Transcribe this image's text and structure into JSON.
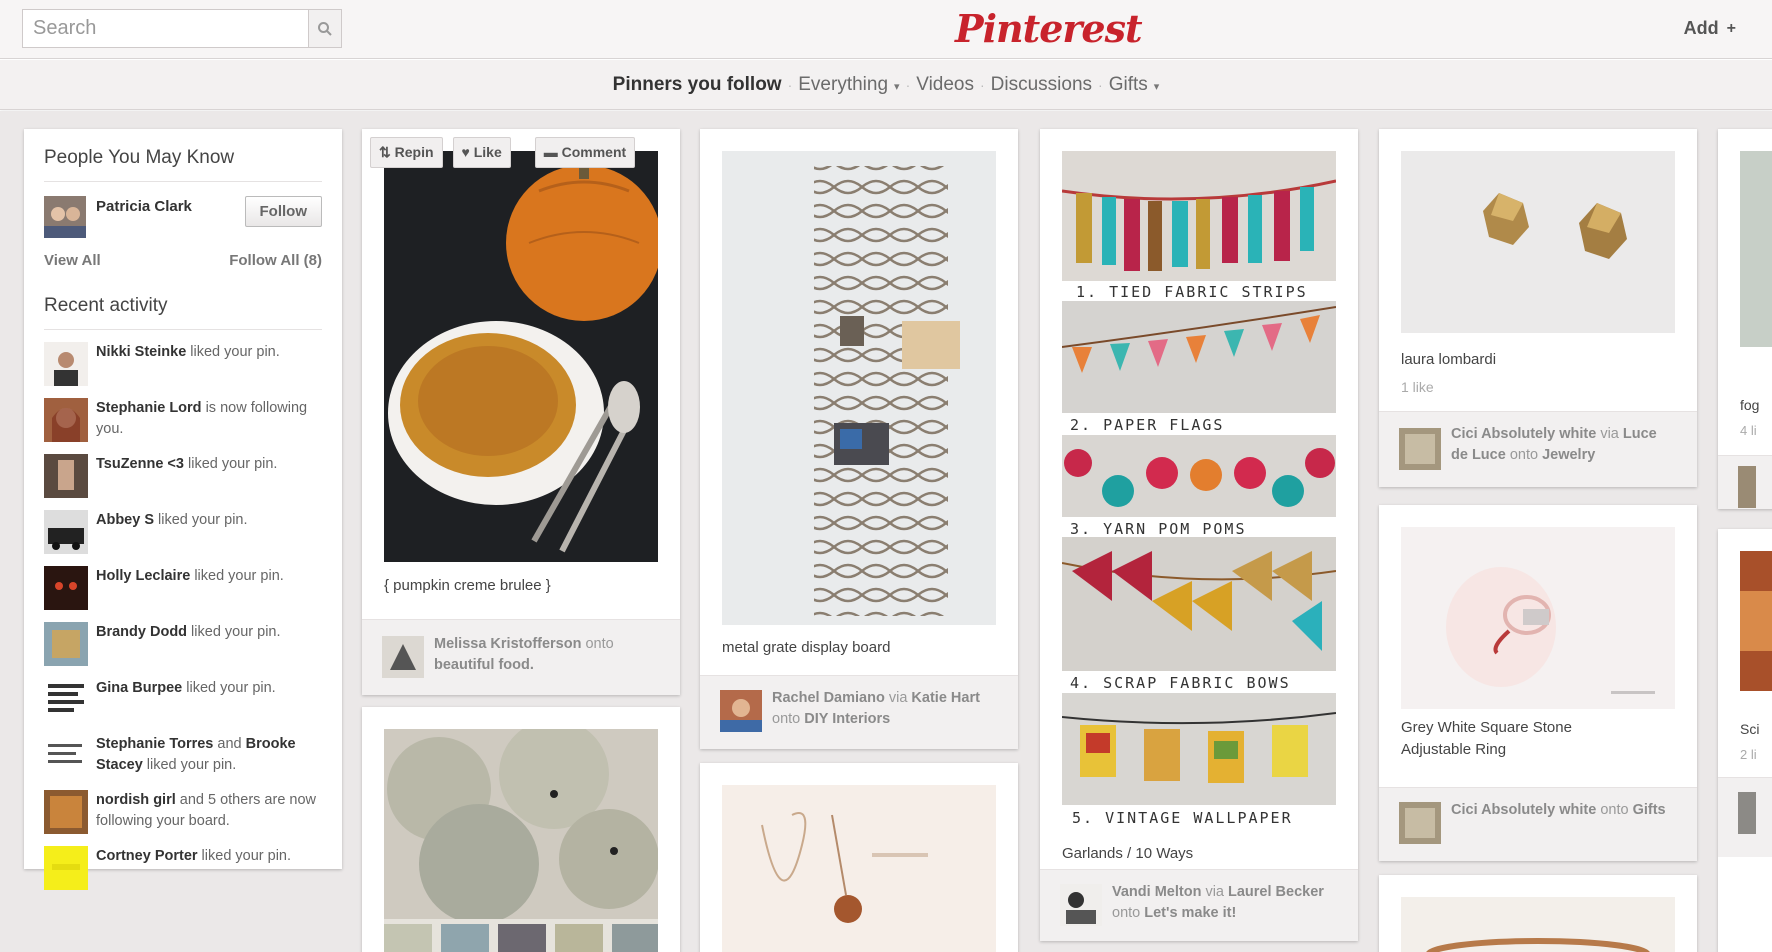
{
  "header": {
    "search": {
      "placeholder": "Search"
    },
    "logo": "Pinterest",
    "add_label": "Add",
    "icons": {
      "search": "search-icon",
      "add": "plus-icon"
    }
  },
  "nav": {
    "items": [
      {
        "label": "Pinners you follow"
      },
      {
        "label": "Everything"
      },
      {
        "label": "Videos"
      },
      {
        "label": "Discussions"
      },
      {
        "label": "Gifts"
      }
    ]
  },
  "sidebar": {
    "people_heading": "People You May Know",
    "person": {
      "name": "Patricia Clark",
      "follow_label": "Follow"
    },
    "view_all": "View All",
    "follow_all": "Follow All (8)",
    "recent_heading": "Recent activity",
    "activity": [
      {
        "name": "Nikki Steinke",
        "text": " liked your pin."
      },
      {
        "name": "Stephanie Lord",
        "text": " is now following you."
      },
      {
        "name": "TsuZenne <3",
        "text": " liked your pin."
      },
      {
        "name": "Abbey S",
        "text": " liked your pin."
      },
      {
        "name": "Holly Leclaire",
        "text": " liked your pin."
      },
      {
        "name": "Brandy Dodd",
        "text": " liked your pin."
      },
      {
        "name": "Gina Burpee",
        "text": " liked your pin."
      },
      {
        "name": "Stephanie Torres",
        "text": " and ",
        "name2": "Brooke Stacey",
        "text2": " liked your pin."
      },
      {
        "name": "nordish girl",
        "text": " and 5 others are now following your board."
      },
      {
        "name": "Cortney Porter",
        "text": " liked your pin."
      }
    ]
  },
  "pins": {
    "pumpkin": {
      "repin": "Repin",
      "like": "Like",
      "comment": "Comment",
      "description": "{ pumpkin creme brulee }",
      "foot_user": "Melissa Kristofferson",
      "foot_onto": " onto ",
      "foot_board": "beautiful food."
    },
    "metal": {
      "description": "metal grate display board",
      "foot_user": "Rachel Damiano",
      "foot_via": " via ",
      "foot_via_user": "Katie Hart",
      "foot_onto": " onto ",
      "foot_board": "DIY Interiors"
    },
    "garlands": {
      "steps": [
        "1. TIED FABRIC STRIPS",
        "2. PAPER FLAGS",
        "3. YARN POM POMS",
        "4. SCRAP FABRIC BOWS",
        "5. VINTAGE WALLPAPER"
      ],
      "description": "Garlands / 10 Ways",
      "foot_user": "Vandi Melton",
      "foot_via": " via ",
      "foot_via_user": "Laurel Becker",
      "foot_onto": " onto ",
      "foot_board": "Let's make it!"
    },
    "studs": {
      "description": "laura lombardi",
      "likes": "1 like",
      "foot_user": "Cici Absolutely white",
      "foot_via": " via ",
      "foot_via_user": "Luce de Luce",
      "foot_onto": " onto ",
      "foot_board": "Jewelry"
    },
    "ring": {
      "description": "Grey White Square Stone Adjustable Ring",
      "foot_user": "Cici Absolutely white",
      "foot_onto": " onto ",
      "foot_board": "Gifts"
    },
    "partial": {
      "text1": "fog",
      "text2": "4 li",
      "text3": "Sci",
      "text4": "2 li"
    }
  }
}
